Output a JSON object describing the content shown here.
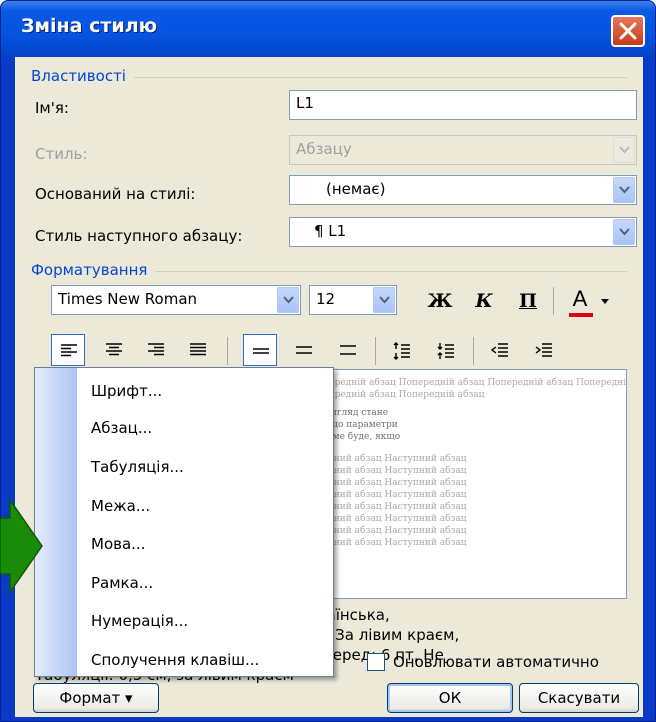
{
  "window": {
    "title": "Зміна стилю"
  },
  "properties": {
    "group_label": "Властивості",
    "name_label": "Ім'я:",
    "name_value": "L1",
    "style_label": "Стиль:",
    "style_value": "Абзацу",
    "based_on_label": "Оснований на стилі:",
    "based_on_value": "(немає)",
    "next_style_label": "Стиль наступного абзацу:",
    "next_style_value": "¶ L1"
  },
  "formatting": {
    "group_label": "Форматування",
    "font_name": "Times New Roman",
    "font_size": "12",
    "bold_label": "Ж",
    "italic_label": "К",
    "underline_label": "П",
    "font_color_label": "A"
  },
  "preview": {
    "lines": [
      "Попередній абзац Попередній абзац Попередній абзац Попередній абзац Попередній абзац Попередній абзац Попередній абзац",
      "Попередній абзац Попередній абзац Попередній абзац Попередній абзац Попередній абзац",
      "Якщо абзацу призначено певний стиль, то його зовнішній вигляд стане",
      "відповідати параметрам форматування, заданих у стилі. Якщо параметри",
      "стилю змінити, вигляд абзацу автоматично зміниться. Те саме буде, якщо",
      "Наступний абзац Наступний абзац Наступний абзац Наступний абзац Наступний абзац",
      "Наступний абзац Наступний абзац Наступний абзац Наступний абзац Наступний абзац",
      "Наступний абзац Наступний абзац Наступний абзац Наступний абзац Наступний абзац",
      "Наступний абзац Наступний абзац Наступний абзац Наступний абзац Наступний абзац",
      "Наступний абзац Наступний абзац Наступний абзац Наступний абзац Наступний абзац",
      "Наступний абзац Наступний абзац Наступний абзац Наступний абзац Наступний абзац",
      "Наступний абзац Наступний абзац Наступний абзац Наступний абзац Наступний абзац",
      "Наступний абзац Наступний абзац Наступний абзац Наступний абзац Наступний абзац"
    ]
  },
  "description": {
    "line1": "Шрифт: Times New Roman, 12 pt, українська,",
    "line2": "Перший рядок: Лівий відступ: 0,5 см, За лівим краєм,",
    "line3": "Міжрядковий: одинарний, інтервал Перед: 6 пт, Не",
    "line4": "Табуляції: 0,5 см, за лівим краєм"
  },
  "auto_update_label": "Оновлювати автоматично",
  "buttons": {
    "format": "Формат ▾",
    "ok": "ОК",
    "cancel": "Скасувати"
  },
  "format_menu": {
    "items": [
      "Шрифт...",
      "Абзац...",
      "Табуляція...",
      "Межа...",
      "Мова...",
      "Рамка...",
      "Нумерація...",
      "Сполучення клавіш..."
    ]
  },
  "colors": {
    "title_bar": "#0a5ae6",
    "group_label": "#0046d5",
    "arrow": "#1a8a0a",
    "font_color_bar": "#e0001a"
  }
}
